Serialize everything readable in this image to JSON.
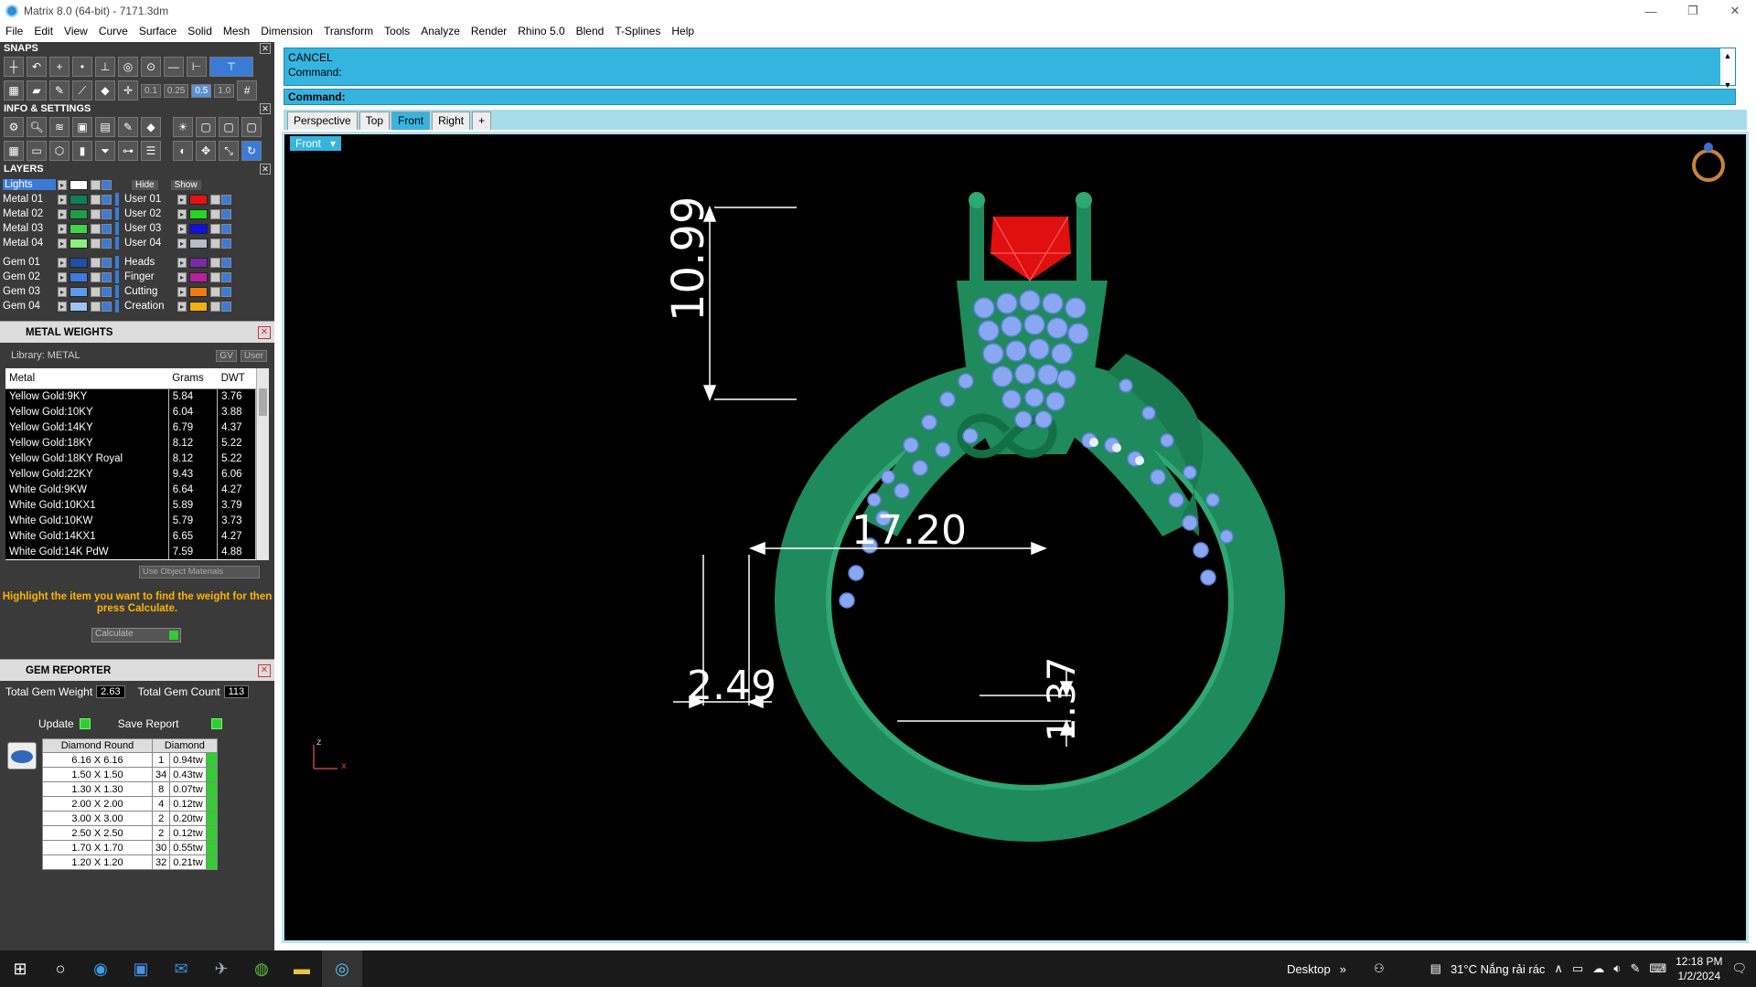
{
  "window": {
    "title": "Matrix 8.0 (64-bit) - 7171.3dm",
    "minimize": "—",
    "restore": "❐",
    "close": "✕"
  },
  "menu": [
    "File",
    "Edit",
    "View",
    "Curve",
    "Surface",
    "Solid",
    "Mesh",
    "Dimension",
    "Transform",
    "Tools",
    "Analyze",
    "Render",
    "Rhino 5.0",
    "Blend",
    "T-Splines",
    "Help"
  ],
  "snaps": {
    "title": "SNAPS",
    "tolerances": [
      "0.1",
      "0.25",
      "0.5",
      "1.0"
    ]
  },
  "info": {
    "title": "INFO & SETTINGS"
  },
  "layers": {
    "title": "LAYERS",
    "lights": "Lights",
    "hide": "Hide",
    "show": "Show",
    "left": [
      {
        "name": "Metal 01",
        "color": "#0e7f5a"
      },
      {
        "name": "Metal 02",
        "color": "#1a9e48"
      },
      {
        "name": "Metal 03",
        "color": "#3fd44a"
      },
      {
        "name": "Metal 04",
        "color": "#8bf07f"
      },
      {
        "name": "Gem 01",
        "color": "#1f4fa8"
      },
      {
        "name": "Gem 02",
        "color": "#3d7be0"
      },
      {
        "name": "Gem 03",
        "color": "#5e98ea"
      },
      {
        "name": "Gem 04",
        "color": "#9cc3f2"
      }
    ],
    "right": [
      {
        "name": "User 01",
        "color": "#e81010"
      },
      {
        "name": "User 02",
        "color": "#22d622"
      },
      {
        "name": "User 03",
        "color": "#1010e0"
      },
      {
        "name": "User 04",
        "color": "#b9b9c8"
      },
      {
        "name": "Heads",
        "color": "#7a2aa8"
      },
      {
        "name": "Finger",
        "color": "#b71fa0"
      },
      {
        "name": "Cutting",
        "color": "#f07a10"
      },
      {
        "name": "Creation",
        "color": "#f0b010"
      }
    ]
  },
  "metal_weights": {
    "title": "METAL WEIGHTS",
    "library": "Library: METAL",
    "gv": "GV",
    "user": "User",
    "columns": [
      "Metal",
      "Grams",
      "DWT"
    ],
    "rows": [
      [
        "Yellow Gold:9KY",
        "5.84",
        "3.76"
      ],
      [
        "Yellow Gold:10KY",
        "6.04",
        "3.88"
      ],
      [
        "Yellow Gold:14KY",
        "6.79",
        "4.37"
      ],
      [
        "Yellow Gold:18KY",
        "8.12",
        "5.22"
      ],
      [
        "Yellow Gold:18KY Royal",
        "8.12",
        "5.22"
      ],
      [
        "Yellow Gold:22KY",
        "9.43",
        "6.06"
      ],
      [
        "White Gold:9KW",
        "6.64",
        "4.27"
      ],
      [
        "White Gold:10KX1",
        "5.89",
        "3.79"
      ],
      [
        "White Gold:10KW",
        "5.79",
        "3.73"
      ],
      [
        "White Gold:14KX1",
        "6.65",
        "4.27"
      ],
      [
        "White Gold:14K PdW",
        "7.59",
        "4.88"
      ]
    ],
    "use_object": "Use Object Materials",
    "hint": "Highlight the item you want to find the weight for then press Calculate.",
    "calculate": "Calculate"
  },
  "gem_reporter": {
    "title": "GEM REPORTER",
    "total_weight_label": "Total Gem Weight",
    "total_weight": "2.63",
    "total_count_label": "Total Gem Count",
    "total_count": "113",
    "update": "Update",
    "save_report": "Save Report",
    "columns": [
      "Diamond Round",
      "Diamond"
    ],
    "rows": [
      [
        "6.16 X 6.16",
        "1",
        "0.94tw"
      ],
      [
        "1.50 X 1.50",
        "34",
        "0.43tw"
      ],
      [
        "1.30 X 1.30",
        "8",
        "0.07tw"
      ],
      [
        "2.00 X 2.00",
        "4",
        "0.12tw"
      ],
      [
        "3.00 X 3.00",
        "2",
        "0.20tw"
      ],
      [
        "2.50 X 2.50",
        "2",
        "0.12tw"
      ],
      [
        "1.70 X 1.70",
        "30",
        "0.55tw"
      ],
      [
        "1.20 X 1.20",
        "32",
        "0.21tw"
      ]
    ]
  },
  "command": {
    "line1": "CANCEL",
    "line2": "Command:",
    "prompt": "Command:"
  },
  "tabs": [
    "Perspective",
    "Top",
    "Front",
    "Right",
    "+"
  ],
  "viewport": {
    "label": "Front",
    "dims": {
      "height": "10.99",
      "width": "17.20",
      "bottom_left": "2.49",
      "bottom_right": "1.37"
    },
    "axis_z": "z",
    "axis_x": "x"
  },
  "taskbar": {
    "desktop": "Desktop",
    "weather": "31°C  Nắng rải rác",
    "time": "12:18 PM",
    "date": "1/2/2024"
  }
}
